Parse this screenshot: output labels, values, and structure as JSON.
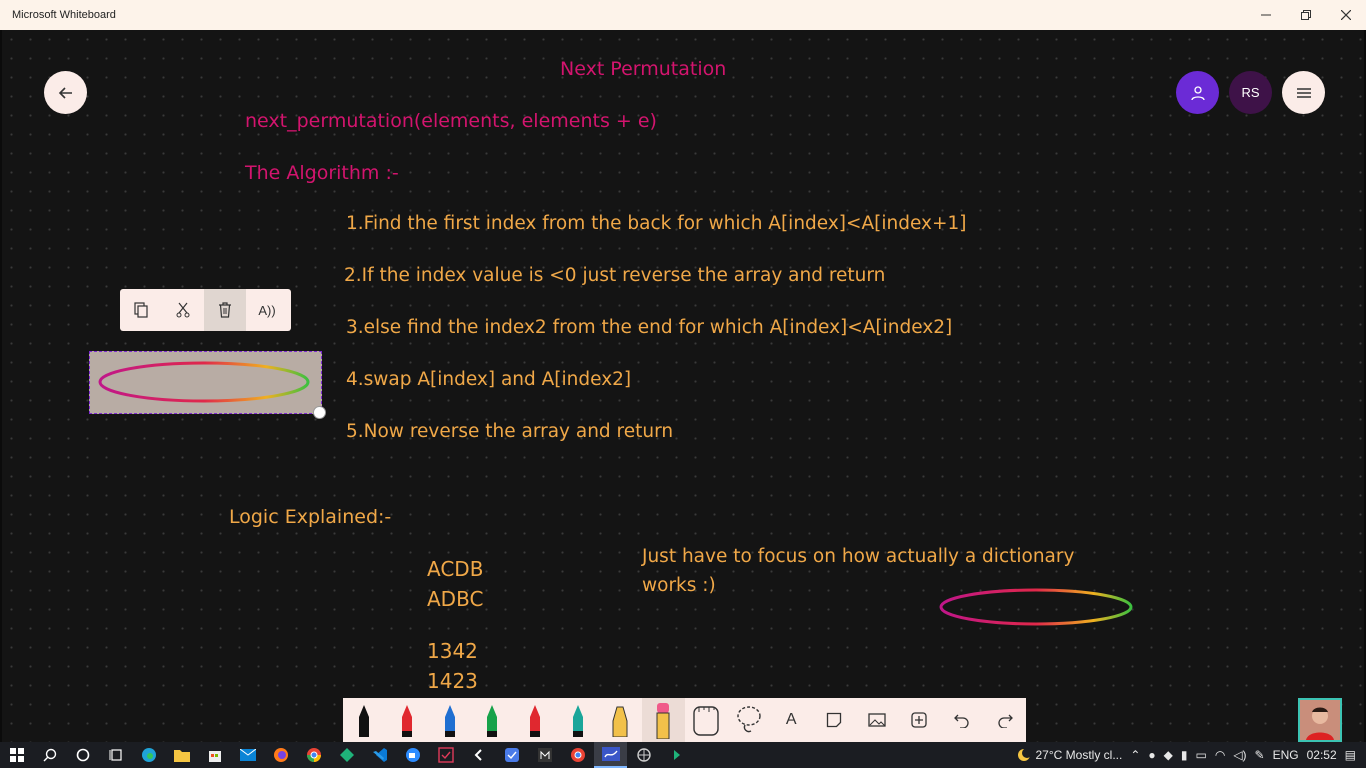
{
  "window": {
    "title": "Microsoft Whiteboard",
    "controls": [
      "minimize",
      "restore",
      "close"
    ]
  },
  "header": {
    "rs_initials": "RS"
  },
  "board": {
    "title": "Next Permutation",
    "signature": "next_permutation(elements, elements + e)",
    "algorithm_heading": "The Algorithm :-",
    "steps": [
      "1.Find the first index from the back for which A[index]<A[index+1]",
      "2.If the index value is <0 just reverse the array and return",
      "3.else find the index2 from the end for which A[index]<A[index2]",
      "4.swap A[index] and A[index2]",
      "5.Now reverse the array and return"
    ],
    "logic_heading": "Logic Explained:-",
    "examples": [
      "ACDB",
      "ADBC",
      "1342",
      "1423"
    ],
    "note_line1": "Just have to focus on how actually a dictionary",
    "note_line2": "works :)"
  },
  "selection_toolbar": {
    "items": [
      "copy-icon",
      "cut-icon",
      "delete-icon",
      "read-aloud-icon"
    ],
    "read_aloud_label": "A))"
  },
  "pen_toolbar": {
    "pens": [
      "#111111",
      "#e0282f",
      "#1f6fd1",
      "#17a24a",
      "#e0282f",
      "#1aa69a",
      "#f2c14a"
    ],
    "items": [
      "eraser-icon",
      "ruler-icon",
      "lasso-icon",
      "text-icon",
      "note-icon",
      "image-icon",
      "add-icon",
      "undo-icon",
      "redo-icon"
    ],
    "text_label": "A"
  },
  "taskbar": {
    "weather": "27°C  Mostly cl...",
    "language": "ENG",
    "time": "02:52"
  },
  "colors": {
    "ink_pink": "#d3146e",
    "ink_orange": "#f0a848",
    "accent_purple": "#6b2bd6"
  }
}
